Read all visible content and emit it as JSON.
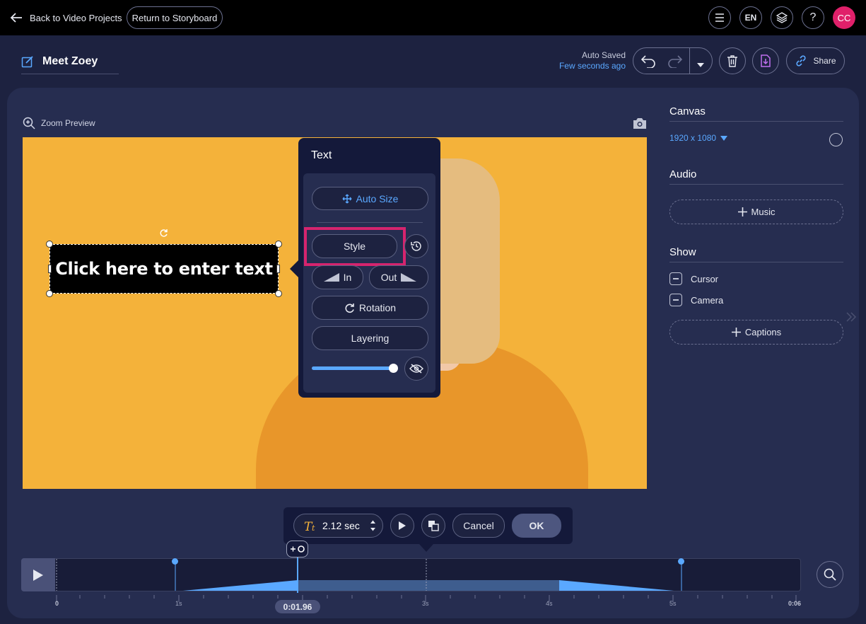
{
  "topbar": {
    "back_label": "Back to Video Projects",
    "storyboard_label": "Return to Storyboard",
    "language": "EN",
    "help": "?",
    "avatar_initials": "CC"
  },
  "project": {
    "title": "Meet Zoey",
    "autosave_status": "Auto Saved",
    "autosave_time": "Few seconds ago",
    "share_label": "Share"
  },
  "preview": {
    "zoom_label": "Zoom Preview",
    "text_placeholder": "Click here to enter text"
  },
  "text_popup": {
    "title": "Text",
    "auto_size_label": "Auto Size",
    "style_label": "Style",
    "in_label": "In",
    "out_label": "Out",
    "rotation_label": "Rotation",
    "layering_label": "Layering",
    "opacity": 1.0
  },
  "right_panel": {
    "canvas_heading": "Canvas",
    "canvas_size": "1920 x 1080",
    "audio_heading": "Audio",
    "music_label": "Music",
    "show_heading": "Show",
    "cursor_label": "Cursor",
    "camera_label": "Camera",
    "captions_label": "Captions"
  },
  "toolbar": {
    "duration": "2.12 sec",
    "cancel_label": "Cancel",
    "ok_label": "OK"
  },
  "timeline": {
    "playhead_time": "0:01.96",
    "tick_labels": [
      "0",
      "1s",
      "2s",
      "3s",
      "4s",
      "5s",
      "0:06"
    ]
  },
  "colors": {
    "accent_blue": "#5aa8ff",
    "highlight_pink": "#d6246e",
    "avatar_pink": "#e0206a"
  }
}
